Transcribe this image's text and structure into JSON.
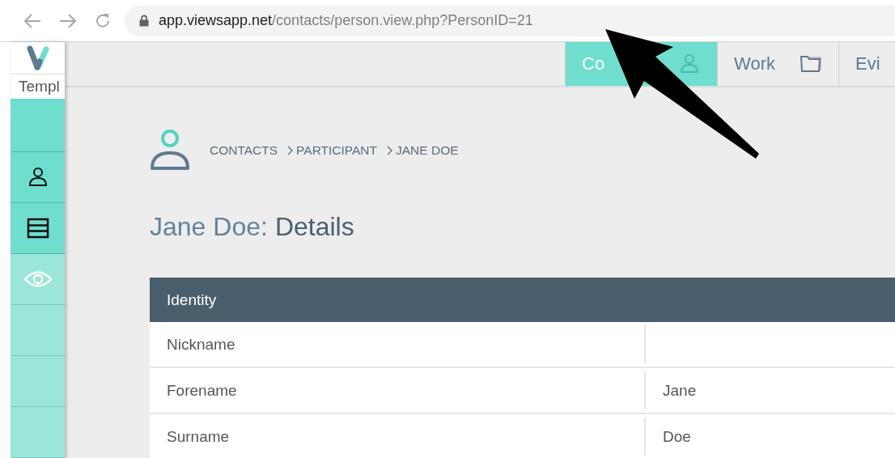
{
  "browser": {
    "url_host": "app.viewsapp.net",
    "url_path": "/contacts/person.view.php?PersonID=21"
  },
  "sidebar": {
    "template_label": "Templ",
    "items": [
      {
        "kind": "blank"
      },
      {
        "kind": "person"
      },
      {
        "kind": "table"
      },
      {
        "kind": "eye"
      },
      {
        "kind": "blank-light"
      },
      {
        "kind": "blank-light"
      },
      {
        "kind": "blank-light"
      }
    ]
  },
  "tabs": [
    {
      "label": "Co",
      "kind": "person",
      "selected": true
    },
    {
      "label": "Work",
      "kind": "folder",
      "selected": false
    },
    {
      "label": "Evi",
      "kind": "none",
      "selected": false
    }
  ],
  "breadcrumb": [
    "CONTACTS",
    "PARTICIPANT",
    "JANE DOE"
  ],
  "title": {
    "subject": "Jane Doe:",
    "section": "Details"
  },
  "card": {
    "title": "Identity",
    "rows": [
      {
        "label": "Nickname"
      },
      {
        "label": "Forename",
        "value": "Jane"
      },
      {
        "label": "Surname",
        "value": "Doe"
      }
    ]
  }
}
